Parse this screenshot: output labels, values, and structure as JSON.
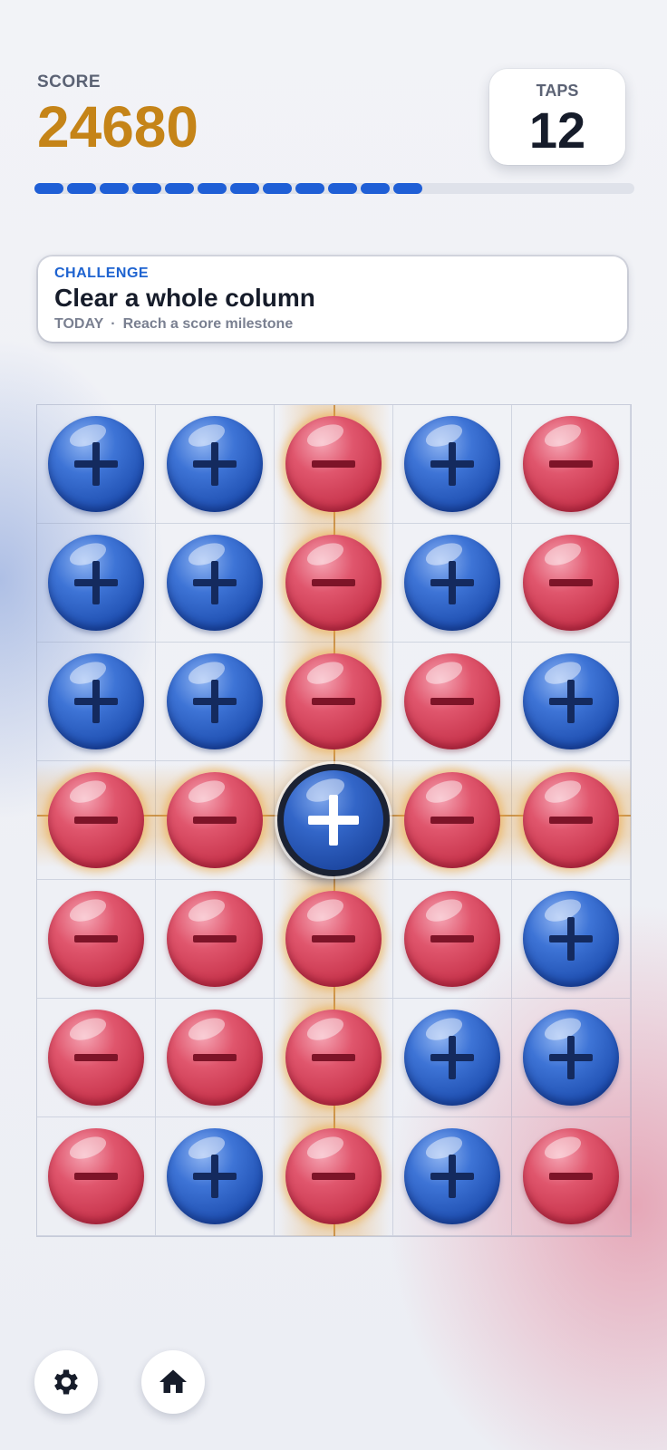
{
  "hud": {
    "score_label": "SCORE",
    "score_value": "24680",
    "taps_label": "TAPS",
    "taps_value": "12",
    "progress": {
      "filled_segments": 12,
      "total_segments": 18,
      "color": "#1f5fd6"
    }
  },
  "challenge": {
    "label": "CHALLENGE",
    "title": "Clear a whole column",
    "when": "TODAY",
    "separator": "·",
    "detail": "Reach a score milestone"
  },
  "board": {
    "rows": 7,
    "cols": 5,
    "grid": [
      [
        "+",
        "+",
        "-",
        "+",
        "-"
      ],
      [
        "+",
        "+",
        "-",
        "+",
        "-"
      ],
      [
        "+",
        "+",
        "-",
        "-",
        "+"
      ],
      [
        "-",
        "-",
        "+",
        "-",
        "-"
      ],
      [
        "-",
        "-",
        "-",
        "-",
        "+"
      ],
      [
        "-",
        "-",
        "-",
        "+",
        "+"
      ],
      [
        "-",
        "+",
        "-",
        "+",
        "-"
      ]
    ],
    "selected": {
      "row": 3,
      "col": 2
    },
    "colors": {
      "plus": "#2f62c8",
      "minus": "#d9465e",
      "highlight": "#e6a03c"
    }
  },
  "footer": {
    "settings_icon": "gear-icon",
    "home_icon": "home-icon"
  }
}
